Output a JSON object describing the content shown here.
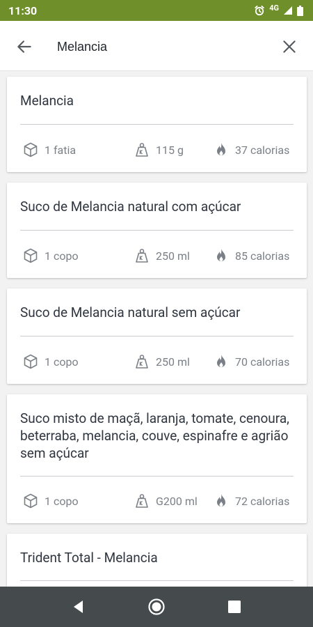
{
  "status_bar": {
    "time": "11:30",
    "network": "4G"
  },
  "search": {
    "query": "Melancia"
  },
  "results": [
    {
      "title": "Melancia",
      "portion": "1 fatia",
      "weight": "115 g",
      "calories": "37 calorias"
    },
    {
      "title": "Suco de Melancia natural com açúcar",
      "portion": "1 copo",
      "weight": "250 ml",
      "calories": "85 calorias"
    },
    {
      "title": "Suco de Melancia natural sem açúcar",
      "portion": "1 copo",
      "weight": "250 ml",
      "calories": "70 calorias"
    },
    {
      "title": "Suco misto de maçã, laranja, tomate, cenoura, beterraba, melancia, couve, espinafre e agrião sem açúcar",
      "portion": "1 copo",
      "weight": "G200 ml",
      "calories": "72 calorias"
    },
    {
      "title": "Trident Total - Melancia"
    }
  ],
  "colors": {
    "status_bar": "#6f8f2a",
    "nav_bar": "#454b4d",
    "text": "#2f3640",
    "muted": "#7b8087"
  }
}
